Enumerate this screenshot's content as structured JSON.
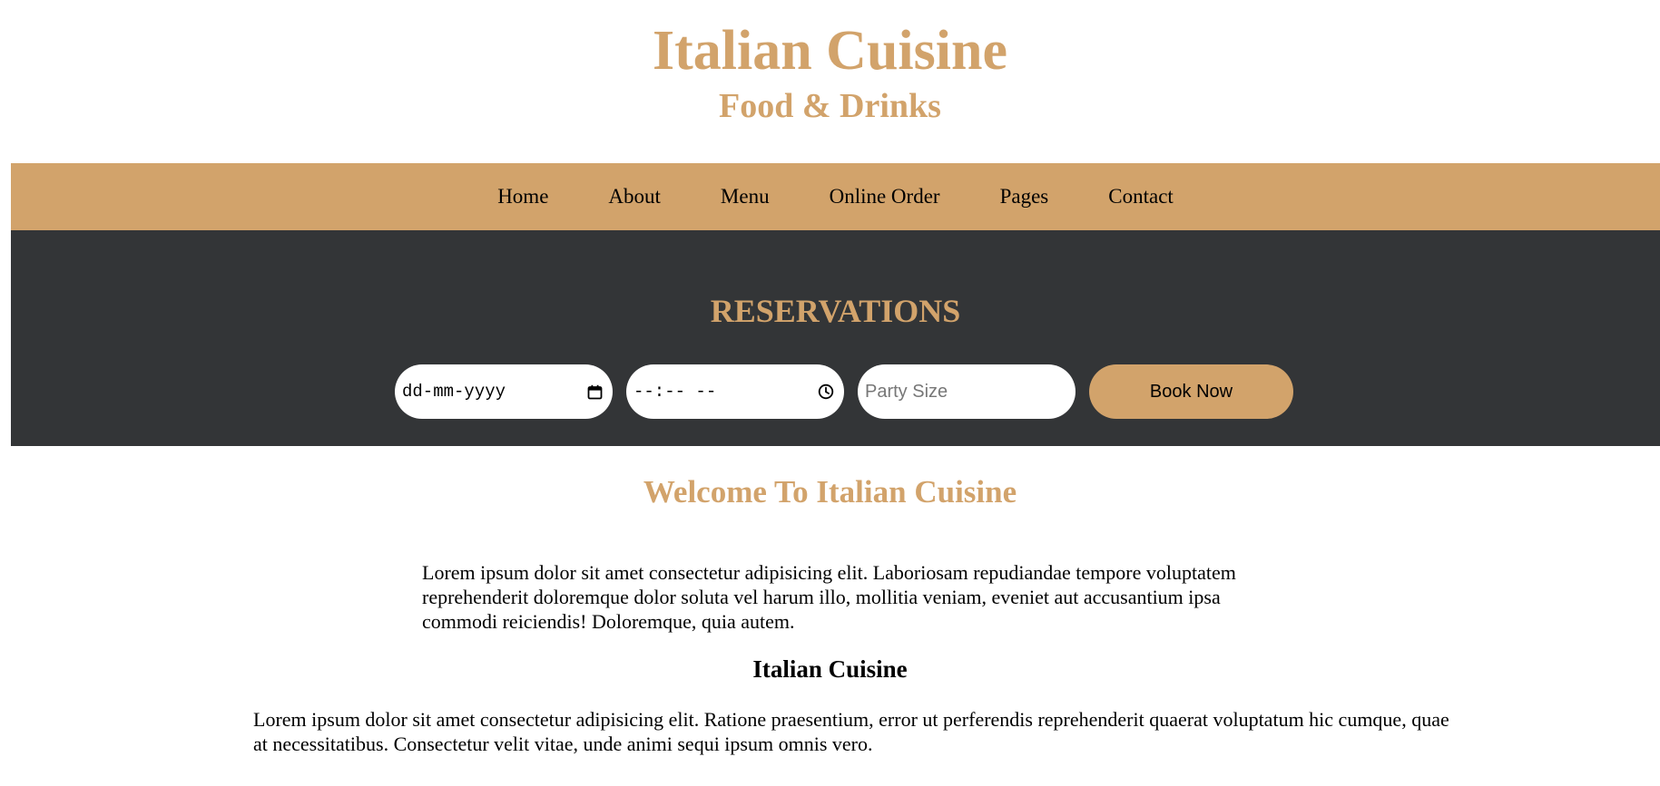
{
  "header": {
    "title": "Italian Cuisine",
    "subtitle": "Food & Drinks"
  },
  "nav": {
    "items": [
      {
        "label": "Home"
      },
      {
        "label": "About"
      },
      {
        "label": "Menu"
      },
      {
        "label": "Online Order"
      },
      {
        "label": "Pages"
      },
      {
        "label": "Contact"
      }
    ]
  },
  "reservations": {
    "title": "RESERVATIONS",
    "date_value": "dd-mm-yyyy",
    "time_value": "--:-- --",
    "party_size_placeholder": "Party Size",
    "book_label": "Book Now"
  },
  "welcome": {
    "heading": "Welcome To Italian Cuisine",
    "intro": "Lorem ipsum dolor sit amet consectetur adipisicing elit. Laboriosam repudiandae tempore voluptatem reprehenderit doloremque dolor soluta vel harum illo, mollitia veniam, eveniet aut accusantium ipsa commodi reiciendis! Doloremque, quia autem."
  },
  "section": {
    "heading": "Italian Cuisine",
    "body": "Lorem ipsum dolor sit amet consectetur adipisicing elit. Ratione praesentium, error ut perferendis reprehenderit quaerat voluptatum hic cumque, quae at necessitatibus. Consectetur velit vitae, unde animi sequi ipsum omnis vero."
  },
  "colors": {
    "accent": "#d2a36b",
    "dark_band": "#333537"
  },
  "icons": {
    "date": "calendar-icon",
    "time": "clock-icon"
  }
}
